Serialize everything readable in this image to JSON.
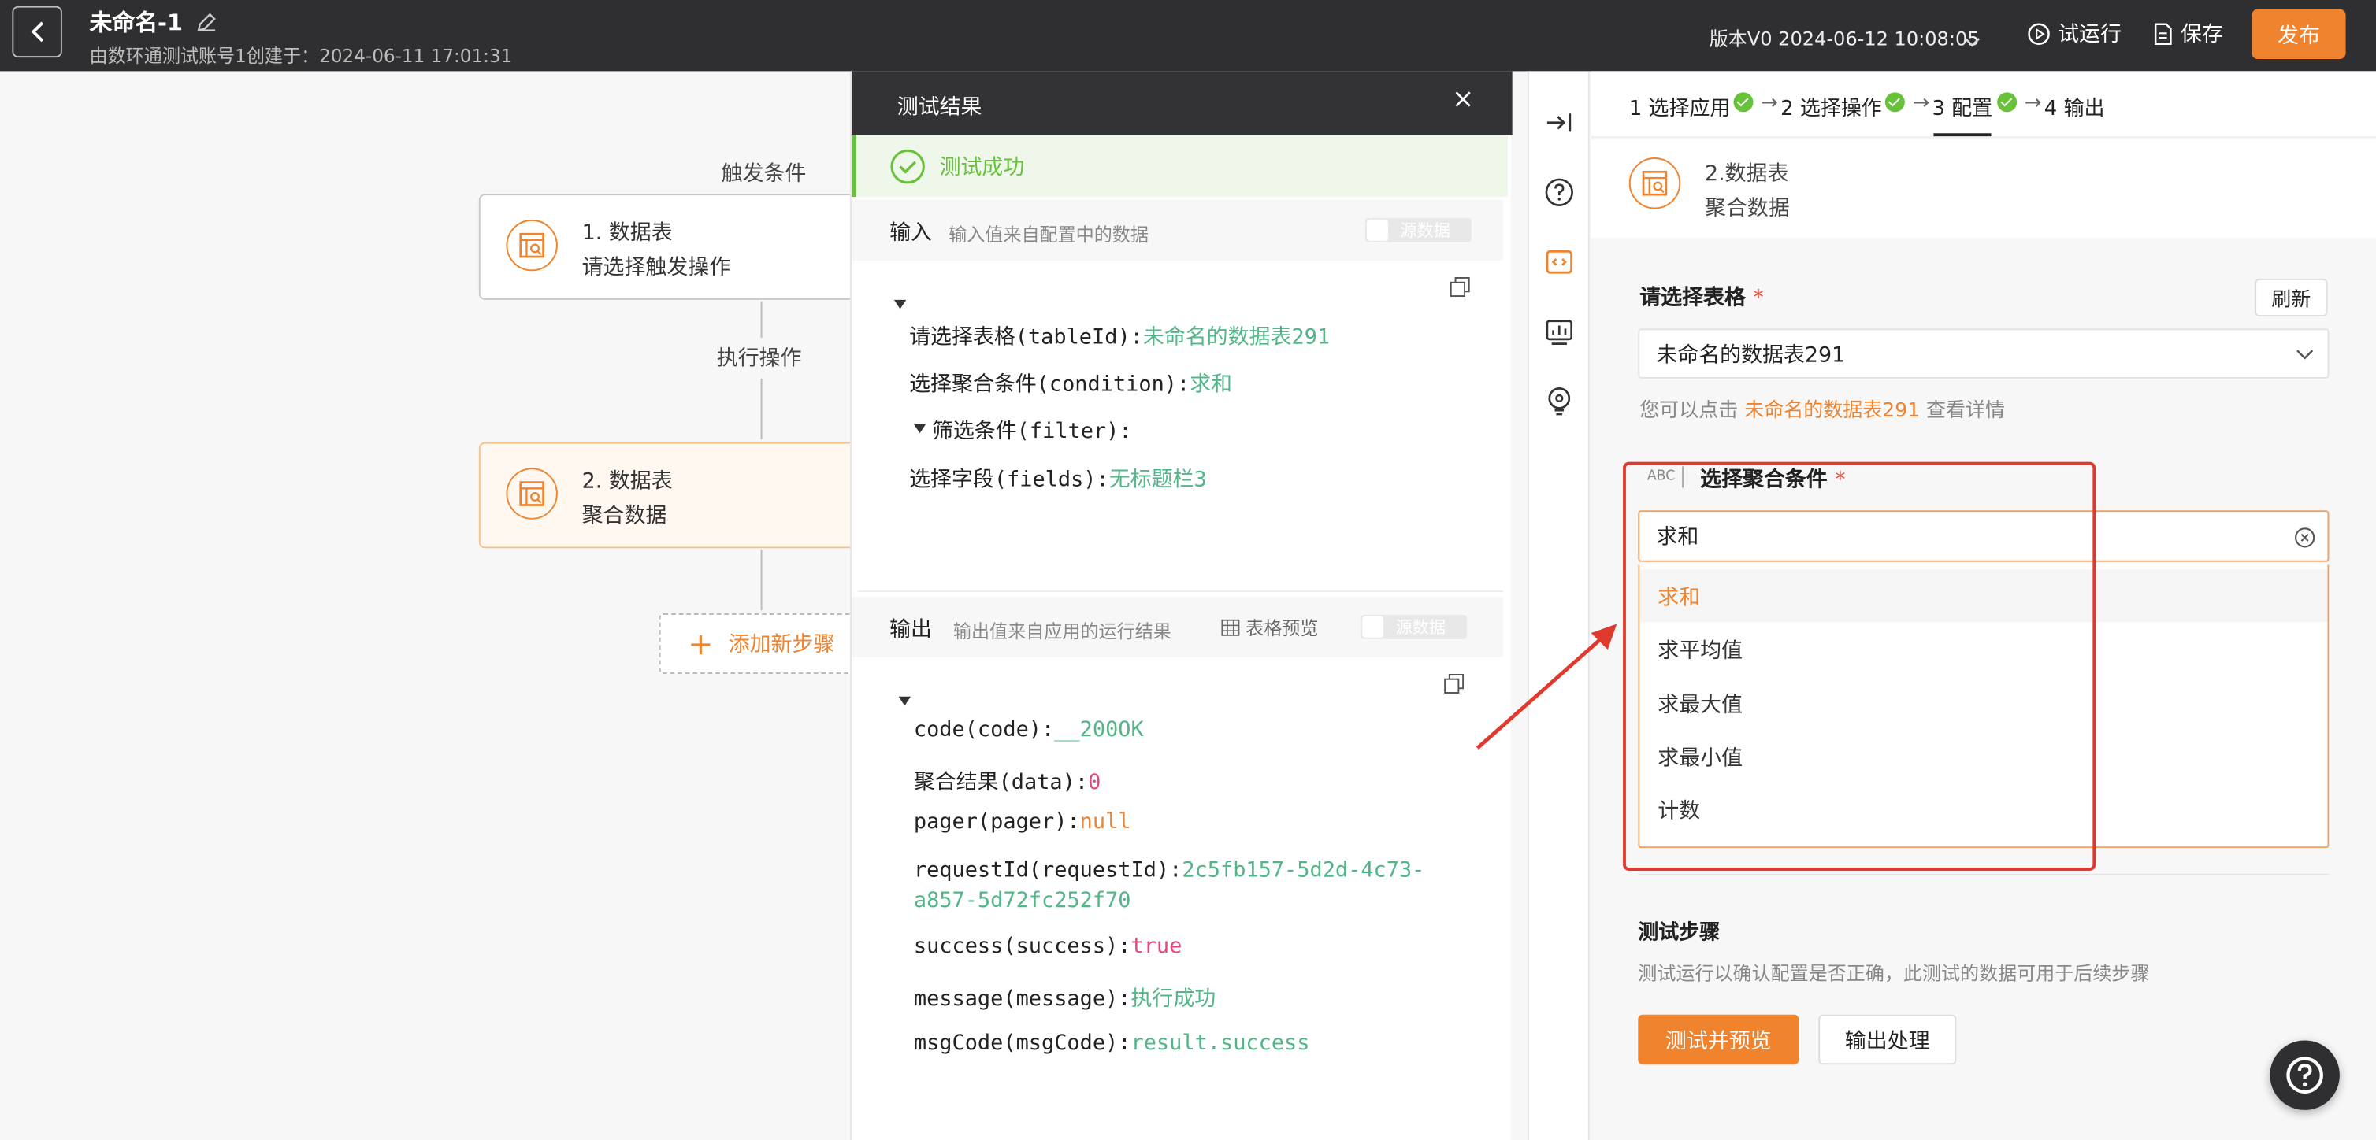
{
  "topbar": {
    "title": "未命名-1",
    "subtitle": "由数环通测试账号1创建于：2024-06-11 17:01:31",
    "version": "版本V0 2024-06-12 10:08:05",
    "trial_run": "试运行",
    "save": "保存",
    "publish": "发布"
  },
  "flow": {
    "trigger_label": "触发条件",
    "exec_label": "执行操作",
    "node1": {
      "line1": "1. 数据表",
      "line2": "请选择触发操作"
    },
    "node2": {
      "line1": "2. 数据表",
      "line2": "聚合数据"
    },
    "add_step": "添加新步骤"
  },
  "test_panel": {
    "title": "测试结果",
    "success": "测试成功",
    "input": {
      "heading": "输入",
      "desc": "输入值来自配置中的数据",
      "toggle": "源数据",
      "rows": [
        {
          "key": "请选择表格(tableId):",
          "value": "未命名的数据表291"
        },
        {
          "key": "选择聚合条件(condition):",
          "value": "求和"
        },
        {
          "key": "筛选条件(filter):",
          "value": ""
        },
        {
          "key": "选择字段(fields):",
          "value": "无标题栏3"
        }
      ]
    },
    "output": {
      "heading": "输出",
      "desc": "输出值来自应用的运行结果",
      "table_preview": "表格预览",
      "toggle": "源数据",
      "rows": [
        {
          "key": "code(code):",
          "value": "__200OK"
        },
        {
          "key": "聚合结果(data):",
          "value": "0"
        },
        {
          "key": "pager(pager):",
          "value": "null"
        },
        {
          "key": "requestId(requestId):",
          "value": "2c5fb157-5d2d-4c73-",
          "value2": "a857-5d72fc252f70"
        },
        {
          "key": "success(success):",
          "value": "true"
        },
        {
          "key": "message(message):",
          "value": "执行成功"
        },
        {
          "key": "msgCode(msgCode):",
          "value": "result.success"
        }
      ]
    }
  },
  "config": {
    "steps": [
      "1 选择应用",
      "2 选择操作",
      "3 配置",
      "4 输出"
    ],
    "header": {
      "line1": "2.数据表",
      "line2": "聚合数据"
    },
    "table_label": "请选择表格",
    "required_mark": "*",
    "refresh": "刷新",
    "table_value": "未命名的数据表291",
    "hint_prefix": "您可以点击",
    "hint_link": "未命名的数据表291",
    "hint_suffix": "查看详情",
    "abc_tag": "ABC",
    "condition_label": "选择聚合条件",
    "condition_value": "求和",
    "options": [
      "求和",
      "求平均值",
      "求最大值",
      "求最小值",
      "计数"
    ],
    "test_step_title": "测试步骤",
    "test_step_desc": "测试运行以确认配置是否正确，此测试的数据可用于后续步骤",
    "btn_test": "测试并预览",
    "btn_output": "输出处理"
  },
  "colors": {
    "accent": "#f0832d",
    "success": "#67c23a",
    "annotation": "#e03a2f"
  }
}
